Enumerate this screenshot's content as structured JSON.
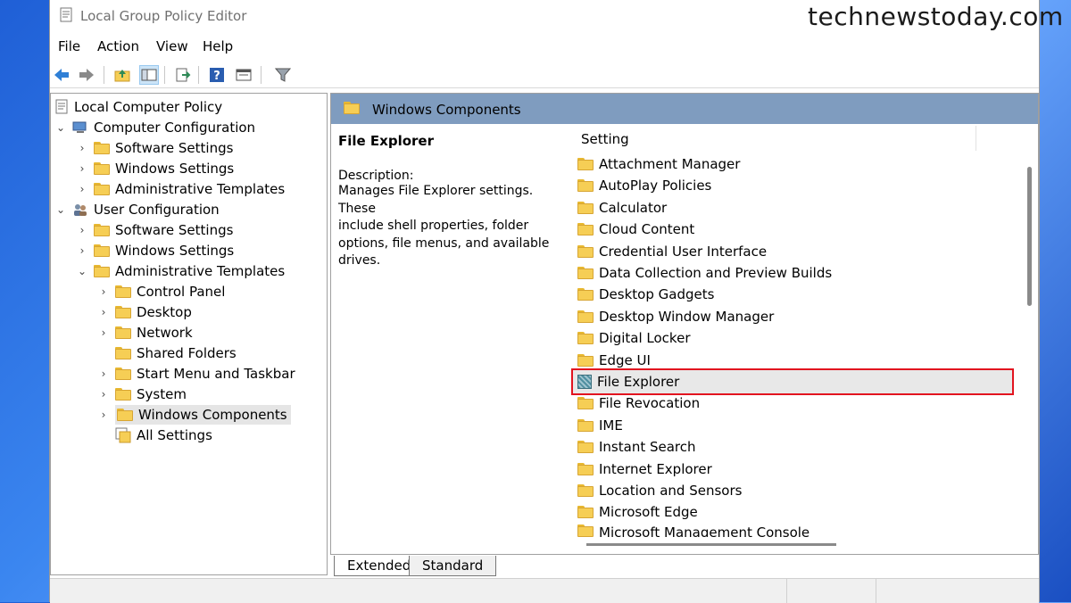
{
  "watermark": "technewstoday.com",
  "window": {
    "title": "Local Group Policy Editor"
  },
  "menu": [
    "File",
    "Action",
    "View",
    "Help"
  ],
  "toolbar": [
    {
      "name": "back-icon"
    },
    {
      "name": "forward-icon"
    },
    {
      "name": "up-folder-icon"
    },
    {
      "name": "show-hide-tree-icon"
    },
    {
      "name": "export-list-icon"
    },
    {
      "name": "help-icon"
    },
    {
      "name": "properties-view-icon"
    },
    {
      "name": "filter-icon"
    }
  ],
  "tree": {
    "root": "Local Computer Policy",
    "computer_config": "Computer Configuration",
    "cc_software": "Software Settings",
    "cc_windows": "Windows Settings",
    "cc_admin": "Administrative Templates",
    "user_config": "User Configuration",
    "uc_software": "Software Settings",
    "uc_windows": "Windows Settings",
    "uc_admin": "Administrative Templates",
    "control_panel": "Control Panel",
    "desktop": "Desktop",
    "network": "Network",
    "shared_folders": "Shared Folders",
    "start_menu": "Start Menu and Taskbar",
    "system": "System",
    "windows_components": "Windows Components",
    "all_settings": "All Settings"
  },
  "right_pane": {
    "header": "Windows Components",
    "detail_title": "File Explorer",
    "description_label": "Description:",
    "description_lines": [
      "Manages File Explorer settings. These",
      "include shell properties, folder",
      "options, file menus, and available",
      "drives."
    ],
    "column_header": "Setting",
    "items": [
      "Attachment Manager",
      "AutoPlay Policies",
      "Calculator",
      "Cloud Content",
      "Credential User Interface",
      "Data Collection and Preview Builds",
      "Desktop Gadgets",
      "Desktop Window Manager",
      "Digital Locker",
      "Edge UI",
      "File Explorer",
      "File Revocation",
      "IME",
      "Instant Search",
      "Internet Explorer",
      "Location and Sensors",
      "Microsoft Edge",
      "Microsoft Management Console"
    ],
    "selected_index": 10
  },
  "tabs": {
    "extended": "Extended",
    "standard": "Standard"
  }
}
